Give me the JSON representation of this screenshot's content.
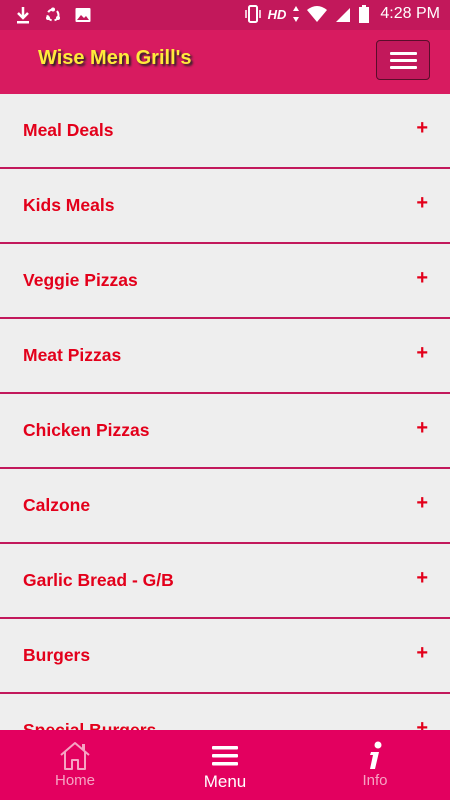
{
  "status_bar": {
    "network": "HD",
    "time": "4:28 PM",
    "icons": [
      "download-icon",
      "sync-icon",
      "image-icon",
      "vibrate-icon",
      "data-arrows-icon",
      "wifi-icon",
      "signal-icon",
      "battery-icon"
    ]
  },
  "header": {
    "title": "Wise Men Grill's",
    "menu_icon": "hamburger-icon"
  },
  "menu": {
    "items": [
      {
        "label": "Meal Deals",
        "expand": "+"
      },
      {
        "label": "Kids Meals",
        "expand": "+"
      },
      {
        "label": "Veggie Pizzas",
        "expand": "+"
      },
      {
        "label": "Meat Pizzas",
        "expand": "+"
      },
      {
        "label": "Chicken Pizzas",
        "expand": "+"
      },
      {
        "label": "Calzone",
        "expand": "+"
      },
      {
        "label": "Garlic Bread - G/B",
        "expand": "+"
      },
      {
        "label": "Burgers",
        "expand": "+"
      },
      {
        "label": "Special Burgers",
        "expand": "+"
      }
    ]
  },
  "bottom_nav": {
    "home": {
      "label": "Home",
      "icon": "home-icon"
    },
    "menu": {
      "label": "Menu",
      "icon": "list-icon",
      "active": true
    },
    "info": {
      "label": "Info",
      "icon": "info-icon"
    }
  },
  "colors": {
    "status_bar": "#c2185b",
    "app_bar": "#d81b60",
    "brand_text": "#ffeb3b",
    "item_text": "#e3001b",
    "divider": "#c2185b",
    "bottom_nav": "#e3005f",
    "list_bg": "#eeeeee"
  }
}
